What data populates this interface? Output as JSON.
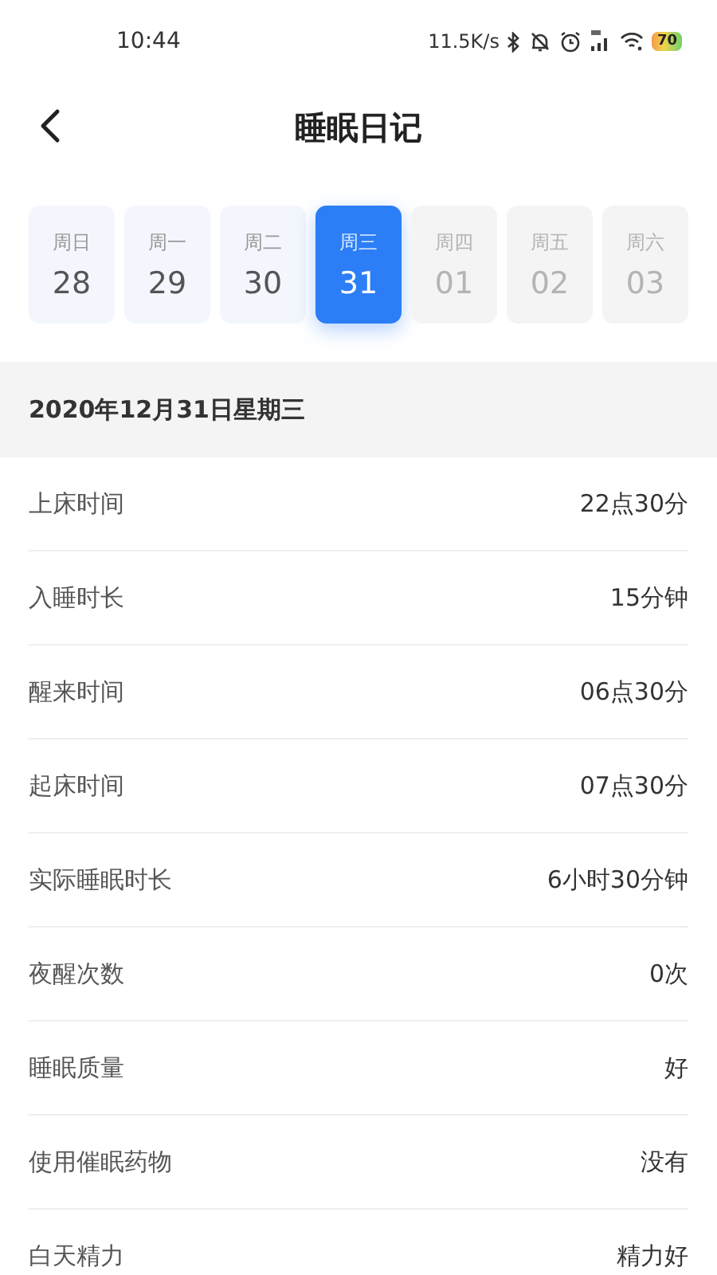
{
  "status_bar": {
    "time": "10:44",
    "speed": "11.5K/s",
    "battery": "70"
  },
  "header": {
    "title": "睡眠日记"
  },
  "days": [
    {
      "weekday": "周日",
      "date": "28",
      "selected": false,
      "disabled": false
    },
    {
      "weekday": "周一",
      "date": "29",
      "selected": false,
      "disabled": false
    },
    {
      "weekday": "周二",
      "date": "30",
      "selected": false,
      "disabled": false
    },
    {
      "weekday": "周三",
      "date": "31",
      "selected": true,
      "disabled": false
    },
    {
      "weekday": "周四",
      "date": "01",
      "selected": false,
      "disabled": true
    },
    {
      "weekday": "周五",
      "date": "02",
      "selected": false,
      "disabled": true
    },
    {
      "weekday": "周六",
      "date": "03",
      "selected": false,
      "disabled": true
    }
  ],
  "section_title": "2020年12月31日星期三",
  "rows": [
    {
      "label": "上床时间",
      "value": "22点30分"
    },
    {
      "label": "入睡时长",
      "value": "15分钟"
    },
    {
      "label": "醒来时间",
      "value": "06点30分"
    },
    {
      "label": "起床时间",
      "value": "07点30分"
    },
    {
      "label": "实际睡眠时长",
      "value": "6小时30分钟"
    },
    {
      "label": "夜醒次数",
      "value": "0次"
    },
    {
      "label": "睡眠质量",
      "value": "好"
    },
    {
      "label": "使用催眠药物",
      "value": "没有"
    },
    {
      "label": "白天精力",
      "value": "精力好"
    }
  ]
}
